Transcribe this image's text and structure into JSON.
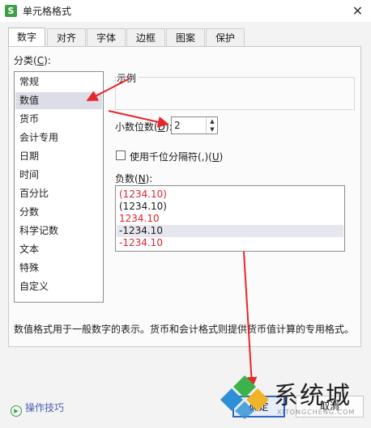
{
  "window": {
    "title": "单元格格式",
    "close_glyph": "✕"
  },
  "tabs": [
    {
      "label": "数字",
      "active": true
    },
    {
      "label": "对齐"
    },
    {
      "label": "字体"
    },
    {
      "label": "边框"
    },
    {
      "label": "图案"
    },
    {
      "label": "保护"
    }
  ],
  "category": {
    "label": "分类(",
    "hotkey": "C",
    "label_end": "):",
    "selected": "数值",
    "items": [
      "常规",
      "数值",
      "货币",
      "会计专用",
      "日期",
      "时间",
      "百分比",
      "分数",
      "科学记数",
      "文本",
      "特殊",
      "自定义"
    ]
  },
  "sample": {
    "label": "示例"
  },
  "decimal": {
    "label": "小数位数(",
    "hotkey": "D",
    "label_end": "):",
    "value": "2"
  },
  "thousands": {
    "label": "使用千位分隔符(,)(",
    "hotkey": "U",
    "label_end": ")",
    "checked": false
  },
  "negative": {
    "label": "负数(",
    "hotkey": "N",
    "label_end": "):",
    "items": [
      {
        "text": "(1234.10)",
        "color": "#e0262b"
      },
      {
        "text": "(1234.10)",
        "color": "#1a1a1a"
      },
      {
        "text": "1234.10",
        "color": "#e0262b"
      },
      {
        "text": "-1234.10",
        "color": "#1a1a1a",
        "selected": true
      },
      {
        "text": "-1234.10",
        "color": "#e0262b"
      }
    ]
  },
  "description": "数值格式用于一般数字的表示。货币和会计格式则提供货币值计算的专用格式。",
  "footer": {
    "tips_label": "操作技巧",
    "tips_icon": "play-circle-icon",
    "ok_label": "确定",
    "cancel_label": "取消"
  },
  "watermark": {
    "brand": "系统城",
    "url": "XITONGCHENG.COM"
  },
  "colors": {
    "accent": "#2f64c8",
    "annotation_arrow": "#e8252b",
    "app_icon": "#3e9f46"
  }
}
